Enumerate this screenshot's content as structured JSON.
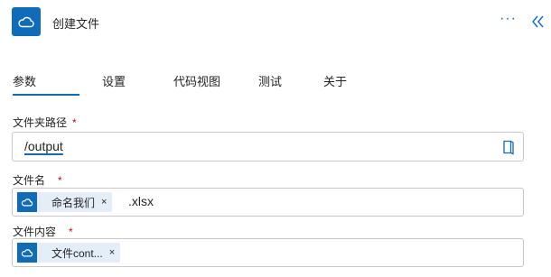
{
  "header": {
    "title": "创建文件",
    "more_label": "···",
    "app_icon": "onedrive-cloud-icon"
  },
  "tabs": [
    {
      "label": "参数",
      "active": true
    },
    {
      "label": "设置"
    },
    {
      "label": "代码视图"
    },
    {
      "label": "测试"
    },
    {
      "label": "关于"
    }
  ],
  "fields": {
    "folder_path": {
      "label": "文件夹路径",
      "required_mark": "*",
      "value": "/output"
    },
    "file_name": {
      "label": "文件名",
      "required_mark": "*",
      "token_label": "命名我们",
      "token_close": "×",
      "suffix": ".xlsx"
    },
    "file_content": {
      "label": "文件内容",
      "required_mark": "*",
      "token_label": "文件cont...",
      "token_close": "×"
    }
  },
  "colors": {
    "accent": "#0f6cbd",
    "required": "#c50f1f",
    "token_bg": "#e3eef9"
  }
}
